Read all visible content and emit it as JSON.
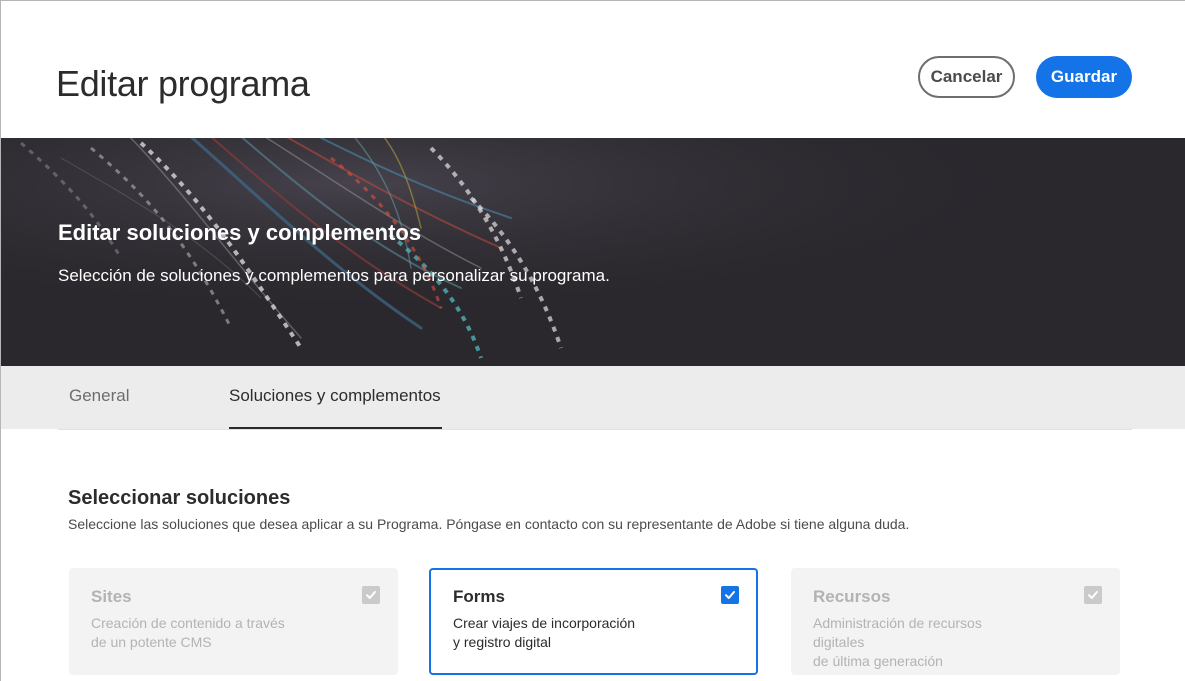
{
  "header": {
    "title": "Editar programa",
    "cancel_label": "Cancelar",
    "save_label": "Guardar"
  },
  "hero": {
    "title": "Editar soluciones y complementos",
    "subtitle": "Selección de soluciones y complementos para personalizar su programa."
  },
  "tabs": [
    {
      "label": "General",
      "selected": false
    },
    {
      "label": "Soluciones y complementos",
      "selected": true
    }
  ],
  "section": {
    "title": "Seleccionar soluciones",
    "description": "Seleccione las soluciones que desea aplicar a su Programa. Póngase en contacto con su representante de Adobe si tiene alguna duda."
  },
  "solutions": [
    {
      "name": "Sites",
      "line1": "Creación de contenido a través",
      "line2": "de un potente CMS",
      "checked": true,
      "disabled": true
    },
    {
      "name": "Forms",
      "line1": "Crear viajes de incorporación",
      "line2": "y registro digital",
      "checked": true,
      "disabled": false
    },
    {
      "name": "Recursos",
      "line1": "Administración de recursos digitales",
      "line2": "de última generación",
      "checked": true,
      "disabled": true
    }
  ],
  "colors": {
    "accent": "#1473e6",
    "hero_background": "#2a282d",
    "tab_bar": "#ececec"
  }
}
